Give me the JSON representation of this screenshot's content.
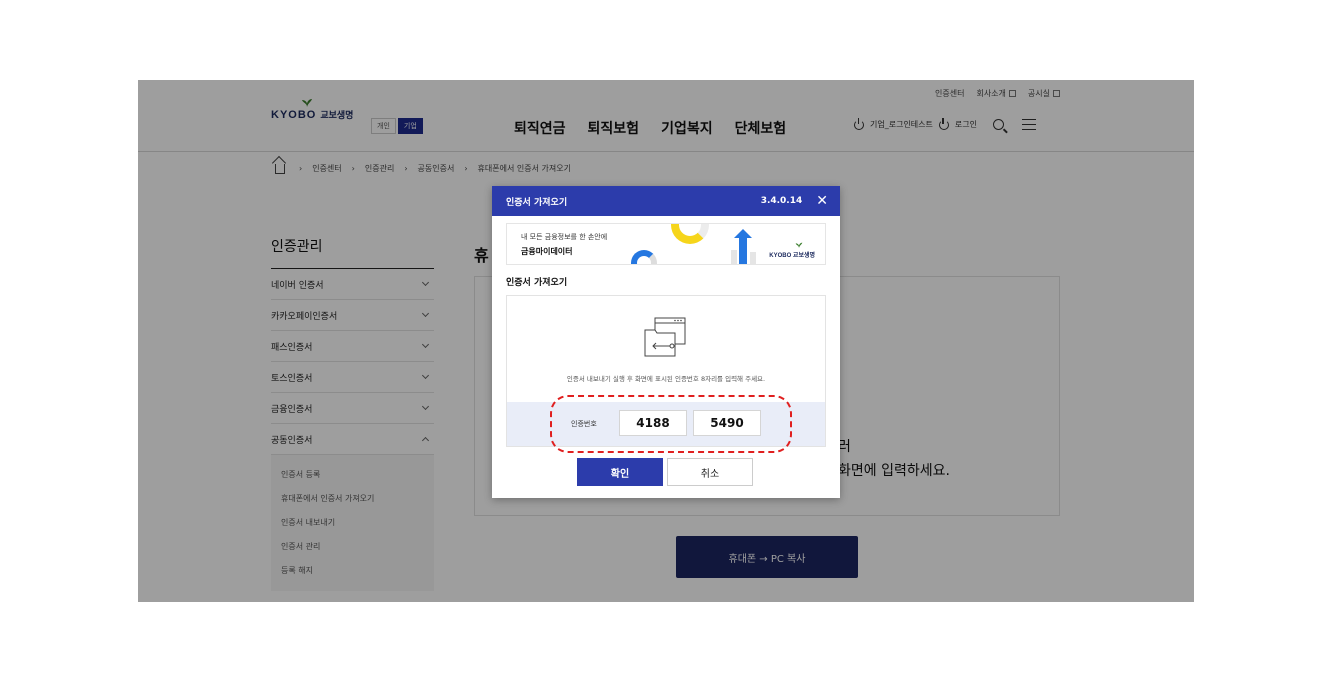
{
  "header": {
    "util_links": [
      "인증센터",
      "회사소개",
      "공시실"
    ],
    "logo_text": "KYOBO",
    "logo_kr": "교보생명",
    "segments": [
      "개인",
      "기업"
    ],
    "gnb": [
      "퇴직연금",
      "퇴직보험",
      "기업복지",
      "단체보험"
    ],
    "user_label": "기업_로그인테스트",
    "login_label": "로그인"
  },
  "breadcrumb": [
    "인증센터",
    "인증관리",
    "공동인증서",
    "휴대폰에서 인증서 가져오기"
  ],
  "sidebar": {
    "title": "인증관리",
    "items": [
      {
        "label": "네이버 인증서"
      },
      {
        "label": "카카오페이인증서"
      },
      {
        "label": "패스인증서"
      },
      {
        "label": "토스인증서"
      },
      {
        "label": "금융인증서"
      },
      {
        "label": "공동인증서"
      }
    ],
    "sub_items": [
      "인증서 등록",
      "휴대폰에서 인증서 가져오기",
      "인증서 내보내기",
      "인증서 관리",
      "등록 해지"
    ]
  },
  "main": {
    "heading": "휴",
    "bg_text1": "러",
    "bg_text2": "화면에 입력하세요.",
    "pc_copy_button": "휴대폰 → PC 복사"
  },
  "modal": {
    "title": "인증서 가져오기",
    "version": "3.4.0.14",
    "banner_line1": "내 모든 금융정보를 한 손안에",
    "banner_line2": "금융마이데이터",
    "banner_logo": "KYOBO 교보생명",
    "section_title": "인증서 가져오기",
    "description": "인증서 내보내기 실행 후 화면에 표시된 인증번호 8자리를 입력해 주세요.",
    "code_label": "인증번호",
    "code_part1": "4188",
    "code_part2": "5490",
    "confirm_label": "확인",
    "cancel_label": "취소"
  },
  "colors": {
    "brand_navy": "#1c2a5e",
    "modal_blue": "#2c3cab",
    "highlight_red": "#e01f1f",
    "accent_yellow": "#f6d51b"
  }
}
